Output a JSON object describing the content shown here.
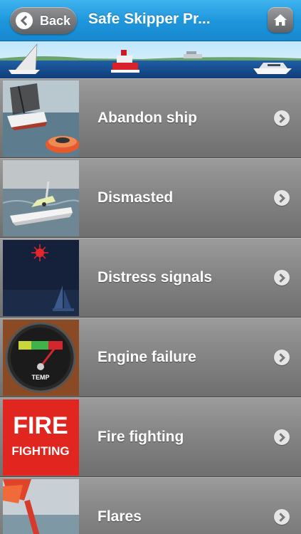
{
  "navbar": {
    "back_label": "Back",
    "title": "Safe Skipper Pr...",
    "colors": {
      "bar": "#1f97dc",
      "button": "#6f7175"
    }
  },
  "banner": {
    "icon": "boats-seascape-image"
  },
  "items": [
    {
      "label": "Abandon ship",
      "icon": "sinking-yacht-liferaft-image"
    },
    {
      "label": "Dismasted",
      "icon": "dismasted-yacht-image"
    },
    {
      "label": "Distress signals",
      "icon": "night-flare-sailboat-image"
    },
    {
      "label": "Engine failure",
      "icon": "temp-gauge-image"
    },
    {
      "label": "Fire fighting",
      "icon": "fire-fighting-sign-image",
      "thumb_text": [
        "FIRE",
        "FIGHTING"
      ]
    },
    {
      "label": "Flares",
      "icon": "handheld-flare-image"
    }
  ],
  "gauge_text": "TEMP"
}
